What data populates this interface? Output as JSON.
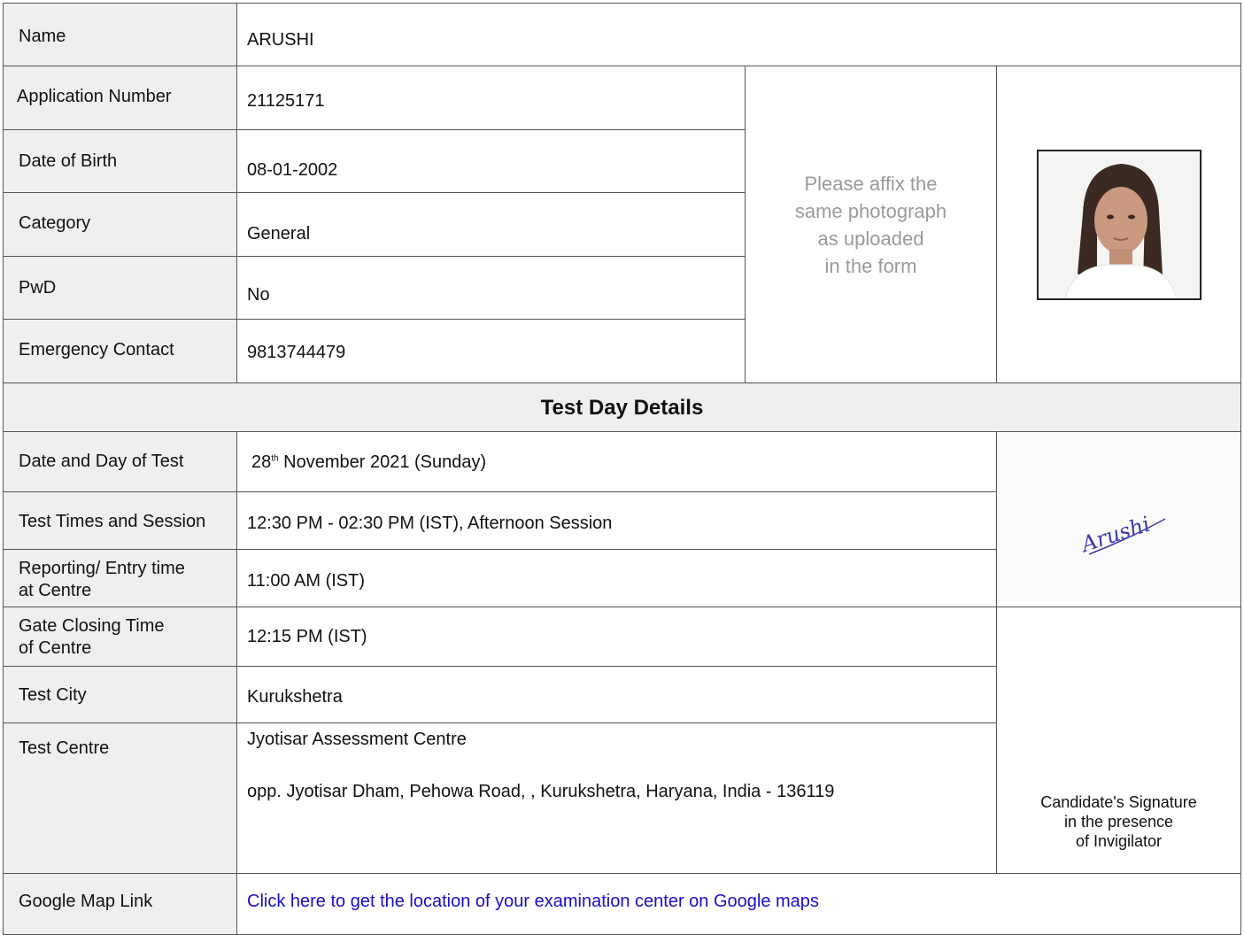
{
  "candidate": {
    "name_label": "Name",
    "name": "ARUSHI",
    "application_number_label": "Application Number",
    "application_number": "21125171",
    "dob_label": "Date of Birth",
    "dob": "08-01-2002",
    "category_label": "Category",
    "category": "General",
    "pwd_label": "PwD",
    "pwd": "No",
    "emergency_label": "Emergency Contact",
    "emergency": "9813744479"
  },
  "photo_note": [
    "Please affix the",
    "same photograph",
    "as uploaded",
    "in the form"
  ],
  "test_day": {
    "heading": "Test Day Details",
    "date_label": "Date and Day of Test",
    "date_day": "28",
    "date_sup": "th",
    "date_rest": " November 2021 (Sunday)",
    "times_label": "Test Times and Session",
    "times": "12:30 PM - 02:30 PM (IST), Afternoon Session",
    "reporting_label": [
      "Reporting/ Entry time",
      "at Centre"
    ],
    "reporting": "11:00 AM (IST)",
    "gate_label": [
      "Gate Closing Time",
      "of Centre"
    ],
    "gate": "12:15 PM (IST)",
    "city_label": "Test City",
    "city": "Kurukshetra",
    "centre_label": "Test Centre",
    "centre_name": "Jyotisar Assessment Centre",
    "centre_address": "opp. Jyotisar Dham, Pehowa Road, , Kurukshetra, Haryana, India - 136119",
    "map_label": "Google Map Link",
    "map_link_text": "Click here to get the location of your examination center on Google maps"
  },
  "signature": {
    "handwritten": "Arushi",
    "caption": [
      "Candidate's Signature",
      "in the presence",
      "of Invigilator"
    ]
  },
  "colors": {
    "label_bg": "#efefef",
    "border": "#555555",
    "link": "#1a0dcc",
    "note": "#9a9a9a"
  }
}
